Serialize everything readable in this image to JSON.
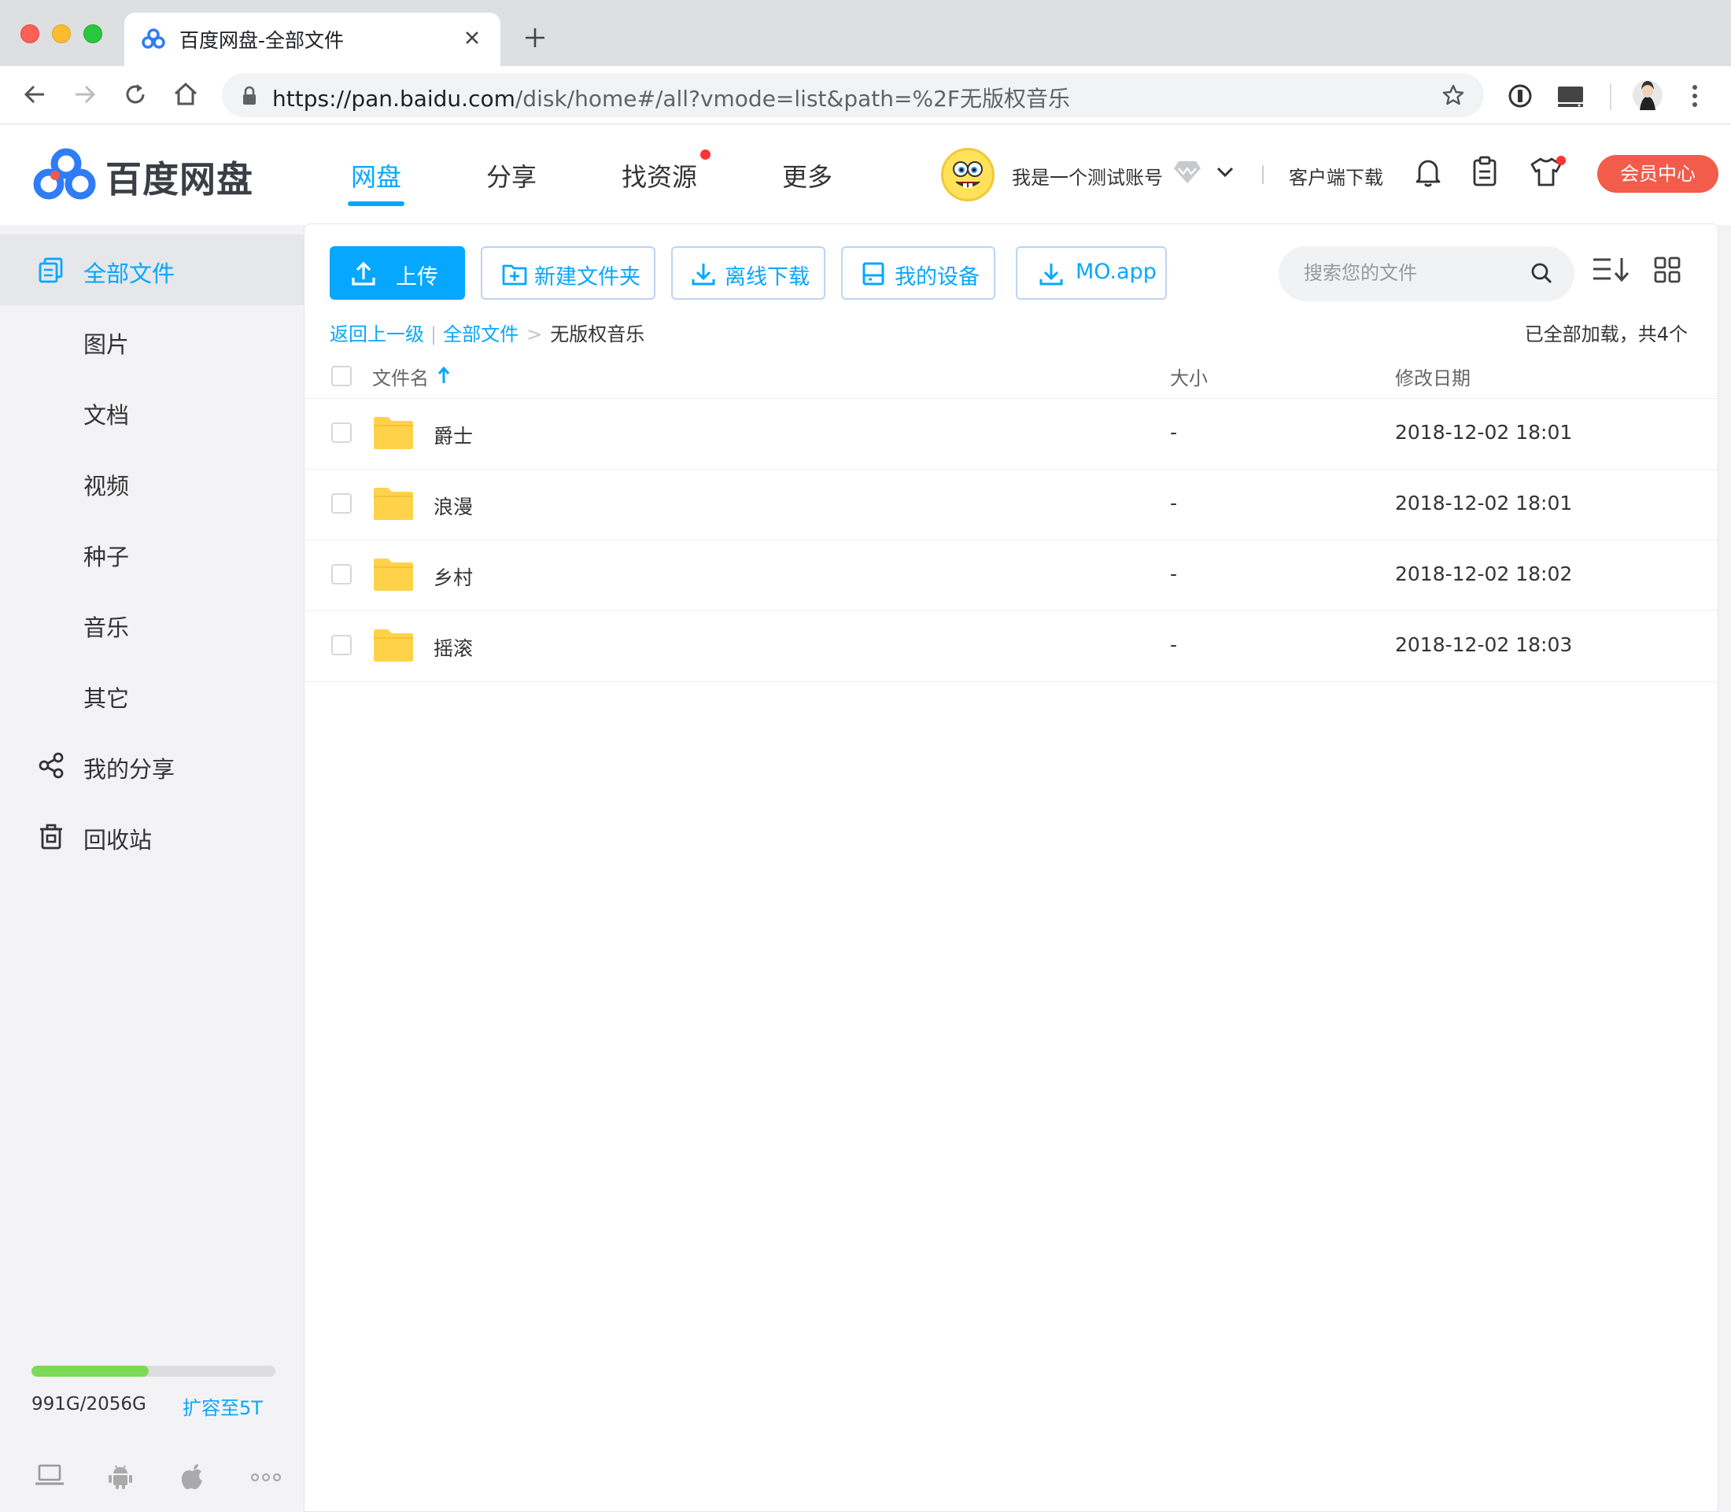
{
  "browser": {
    "tab_title": "百度网盘-全部文件",
    "url_host": "https://pan.baidu.com",
    "url_path": "/disk/home#/all?vmode=list&path=%2F无版权音乐"
  },
  "header": {
    "logo_text": "百度网盘",
    "nav": [
      {
        "label": "网盘",
        "active": true
      },
      {
        "label": "分享"
      },
      {
        "label": "找资源",
        "badge": true
      },
      {
        "label": "更多"
      }
    ],
    "username": "我是一个测试账号",
    "client_download": "客户端下载",
    "vip_center": "会员中心"
  },
  "sidebar": {
    "items": [
      {
        "label": "全部文件",
        "active": true,
        "icon": "files-icon"
      },
      {
        "label": "图片"
      },
      {
        "label": "文档"
      },
      {
        "label": "视频"
      },
      {
        "label": "种子"
      },
      {
        "label": "音乐"
      },
      {
        "label": "其它"
      },
      {
        "label": "我的分享",
        "icon": "share-icon"
      },
      {
        "label": "回收站",
        "icon": "trash-icon"
      }
    ],
    "quota": {
      "used_text": "991G/2056G",
      "used": 991,
      "total": 2056,
      "expand_label": "扩容至5T"
    },
    "platforms": [
      "laptop-icon",
      "android-icon",
      "apple-icon",
      "more-icon"
    ]
  },
  "toolbar": {
    "upload": "上传",
    "new_folder": "新建文件夹",
    "offline_download": "离线下载",
    "my_devices": "我的设备",
    "mo_app": "MO.app",
    "search_placeholder": "搜索您的文件"
  },
  "breadcrumb": {
    "back": "返回上一级",
    "root": "全部文件",
    "separator": ">",
    "current": "无版权音乐"
  },
  "loaded_status": "已全部加载，共4个",
  "table": {
    "columns": {
      "name": "文件名",
      "size": "大小",
      "modified": "修改日期"
    },
    "rows": [
      {
        "name": "爵士",
        "size": "-",
        "modified": "2018-12-02 18:01"
      },
      {
        "name": "浪漫",
        "size": "-",
        "modified": "2018-12-02 18:01"
      },
      {
        "name": "乡村",
        "size": "-",
        "modified": "2018-12-02 18:02"
      },
      {
        "name": "摇滚",
        "size": "-",
        "modified": "2018-12-02 18:03"
      }
    ]
  },
  "colors": {
    "accent": "#06a7ff",
    "vip": "#f35b4a",
    "quota": "#7ed957",
    "folder": "#ffd24a"
  }
}
